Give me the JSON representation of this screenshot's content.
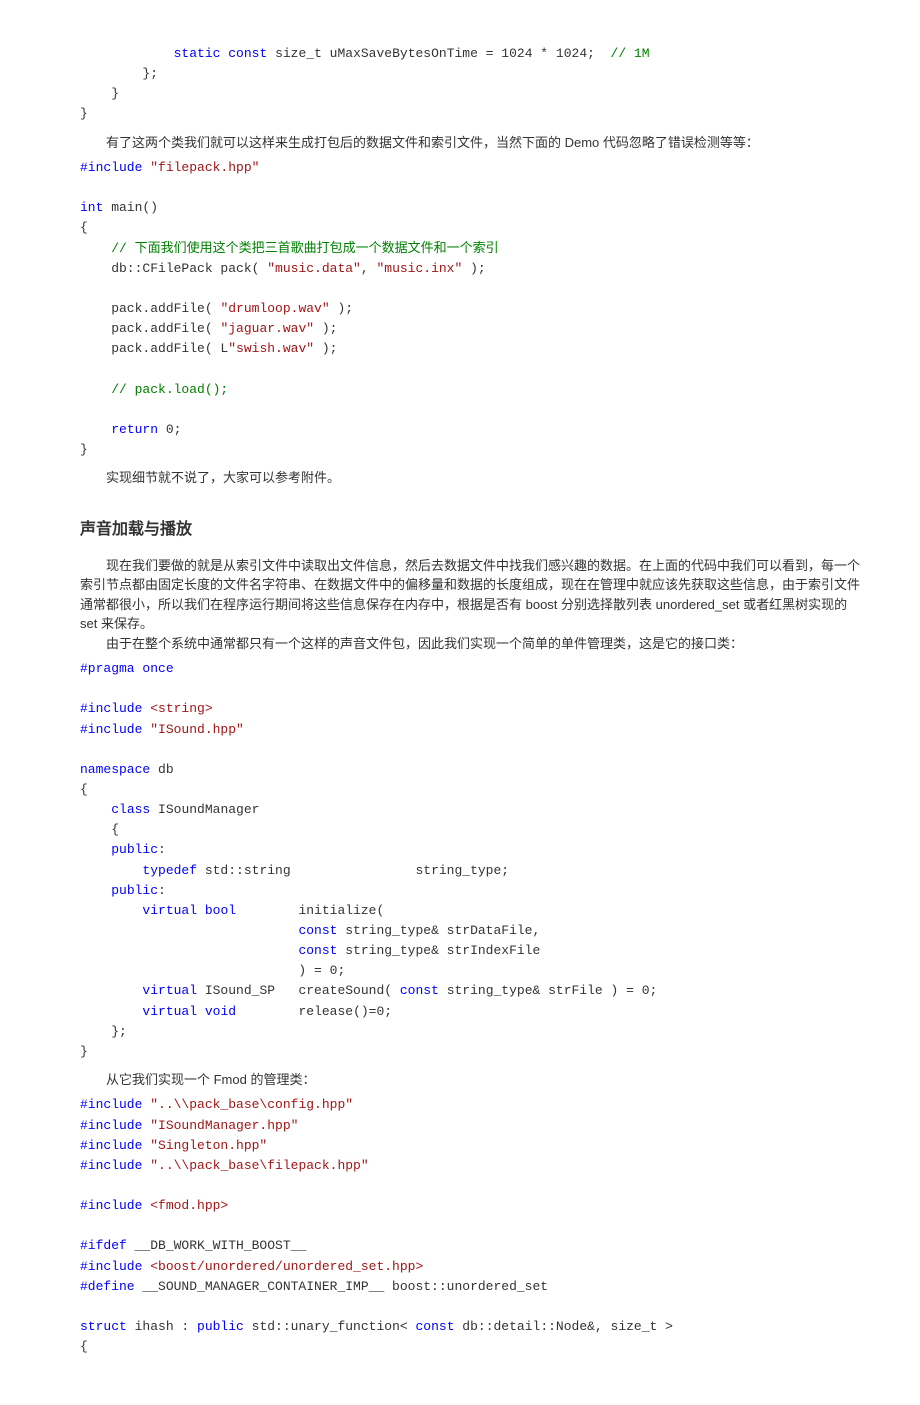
{
  "code1": {
    "l1": "            ",
    "l1_kw1": "static",
    "l1_kw2": "const",
    "l1_rest": " size_t uMaxSaveBytesOnTime = 1024 * 1024;  ",
    "l1_com": "// 1M",
    "l2": "        };",
    "l3": "    }",
    "l4": "}"
  },
  "para1": "有了这两个类我们就可以这样来生成打包后的数据文件和索引文件，当然下面的 Demo 代码忽略了错误检测等等：",
  "code2": {
    "inc1_pp": "#include ",
    "inc1_s": "\"filepack.hpp\"",
    "blank": "",
    "main_kw": "int",
    "main_rest": " main()",
    "lb": "{",
    "com1": "    // 下面我们使用这个类把三首歌曲打包成一个数据文件和一个索引",
    "l_pack": "    db::CFilePack pack( ",
    "s_music_data": "\"music.data\"",
    "s_sep": ", ",
    "s_music_inx": "\"music.inx\"",
    "l_pack_end": " );",
    "add1_a": "    pack.addFile( ",
    "add1_s": "\"drumloop.wav\"",
    "add1_e": " );",
    "add2_a": "    pack.addFile( ",
    "add2_s": "\"jaguar.wav\"",
    "add2_e": " );",
    "add3_a": "    pack.addFile( L",
    "add3_s": "\"swish.wav\"",
    "add3_e": " );",
    "com2": "    // pack.load();",
    "ret_pre": "    ",
    "ret_kw": "return",
    "ret_post": " 0;",
    "rb": "}"
  },
  "para2": "实现细节就不说了，大家可以参考附件。",
  "section_title": "声音加载与播放",
  "para3": "现在我们要做的就是从索引文件中读取出文件信息，然后去数据文件中找我们感兴趣的数据。在上面的代码中我们可以看到，每一个索引节点都由固定长度的文件名字符串、在数据文件中的偏移量和数据的长度组成，现在在管理中就应该先获取这些信息，由于索引文件通常都很小，所以我们在程序运行期间将这些信息保存在内存中，根据是否有 boost 分别选择散列表 unordered_set 或者红黑树实现的 set 来保存。",
  "para4": "由于在整个系统中通常都只有一个这样的声音文件包，因此我们实现一个简单的单件管理类，这是它的接口类：",
  "code3": {
    "pragma": "#pragma",
    "pragma_rest": " once",
    "inc1a": "#include ",
    "inc1b": "<string>",
    "inc2a": "#include ",
    "inc2b": "\"ISound.hpp\"",
    "ns_kw": "namespace",
    "ns_rest": " db",
    "lb": "{",
    "cls_pre": "    ",
    "cls_kw": "class",
    "cls_name": " ISoundManager",
    "clb": "    {",
    "pub1_pre": "    ",
    "pub1_kw": "public",
    "pub1_colon": ":",
    "td_pre": "        ",
    "td_kw": "typedef",
    "td_rest": " std::string                string_type;",
    "pub2_pre": "    ",
    "pub2_kw": "public",
    "pub2_colon": ":",
    "v1_pre": "        ",
    "v1_virtual": "virtual",
    "v1_sp1": " ",
    "v1_bool": "bool",
    "v1_rest": "        initialize(",
    "v1l2_pre": "                            ",
    "v1l2_const": "const",
    "v1l2_rest": " string_type& strDataFile,",
    "v1l3_pre": "                            ",
    "v1l3_const": "const",
    "v1l3_rest": " string_type& strIndexFile",
    "v1l4": "                            ) = 0;",
    "v2_pre": "        ",
    "v2_virtual": "virtual",
    "v2_rest": " ISound_SP   createSound( ",
    "v2_const": "const",
    "v2_rest2": " string_type& strFile ) = 0;",
    "v3_pre": "        ",
    "v3_virtual": "virtual",
    "v3_sp": " ",
    "v3_void": "void",
    "v3_rest": "        release()=0;",
    "crb": "    };",
    "rb": "}"
  },
  "para5": "从它我们实现一个 Fmod 的管理类：",
  "code4": {
    "inc1a": "#include ",
    "inc1b": "\"..\\\\pack_base\\config.hpp\"",
    "inc2a": "#include ",
    "inc2b": "\"ISoundManager.hpp\"",
    "inc3a": "#include ",
    "inc3b": "\"Singleton.hpp\"",
    "inc4a": "#include ",
    "inc4b": "\"..\\\\pack_base\\filepack.hpp\"",
    "inc5a": "#include ",
    "inc5b": "<fmod.hpp>",
    "ifdef": "#ifdef",
    "ifdef_rest": " __DB_WORK_WITH_BOOST__",
    "inc6a": "#include ",
    "inc6b": "<boost/unordered/unordered_set.hpp>",
    "def": "#define",
    "def_rest": " __SOUND_MANAGER_CONTAINER_IMP__ boost::unordered_set",
    "struct_kw": "struct",
    "struct_mid": " ihash : ",
    "struct_pub": "public",
    "struct_rest": " std::unary_function< ",
    "struct_const": "const",
    "struct_rest2": " db::detail::Node&, size_t >",
    "lb": "{"
  }
}
